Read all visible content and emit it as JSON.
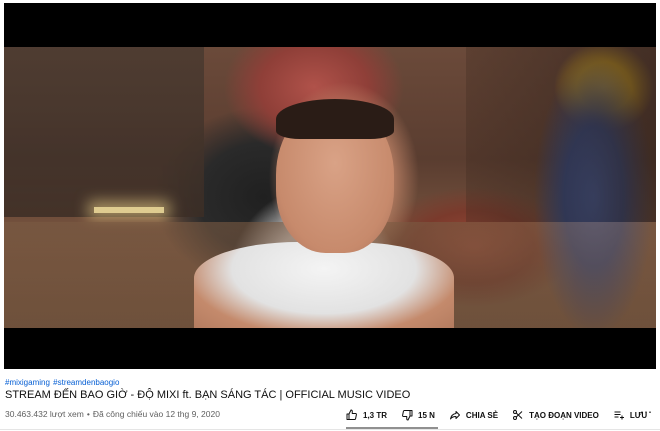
{
  "video": {
    "hashtags": [
      "#mixigaming",
      "#streamdenbaogio"
    ],
    "title": "STREAM ĐẾN BAO GIỜ - ĐỘ MIXI ft. BẠN SÁNG TÁC | OFFICIAL MUSIC VIDEO",
    "views": "30.463.432 lượt xem",
    "published": "Đã công chiếu vào 12 thg 9, 2020"
  },
  "actions": {
    "like_count": "1,3 TR",
    "dislike_count": "15 N",
    "share_label": "CHIA SẺ",
    "clip_label": "TẠO ĐOẠN VIDEO",
    "save_label": "LƯU",
    "more_label": "⋯"
  },
  "icons": {
    "like": "thumbs-up-icon",
    "dislike": "thumbs-down-icon",
    "share": "share-arrow-icon",
    "clip": "scissors-icon",
    "save": "add-to-playlist-icon",
    "more": "more-horizontal-icon"
  }
}
